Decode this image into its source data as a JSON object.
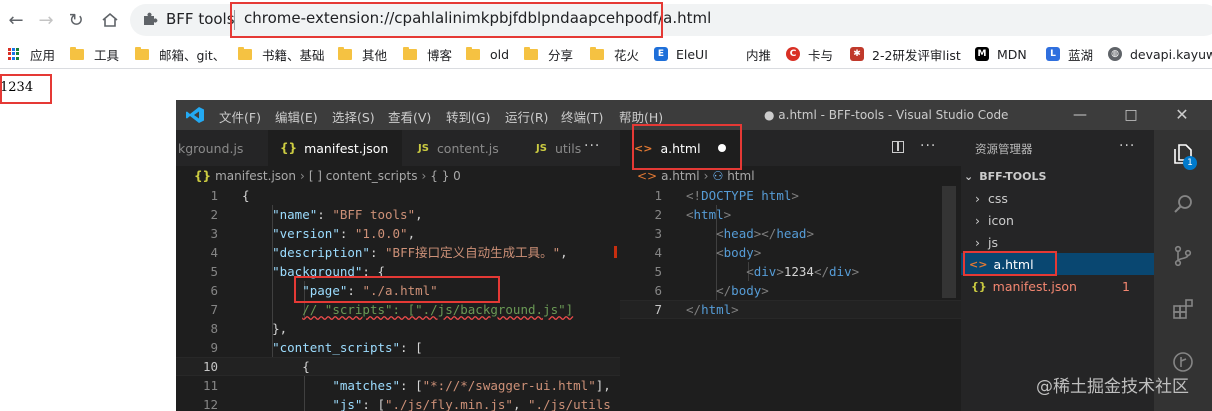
{
  "browser": {
    "site_chip": "BFF tools",
    "url": "chrome-extension://cpahlalinimkpbjfdblpndaapcehpodf/a.html",
    "bookmarks": [
      {
        "label": "应用",
        "icon": "apps-grid-icon"
      },
      {
        "label": "工具",
        "icon": "folder-icon"
      },
      {
        "label": "邮箱、git、",
        "icon": "folder-icon"
      },
      {
        "label": "书籍、基础",
        "icon": "folder-icon"
      },
      {
        "label": "其他",
        "icon": "folder-icon"
      },
      {
        "label": "博客",
        "icon": "folder-icon"
      },
      {
        "label": "old",
        "icon": "folder-icon"
      },
      {
        "label": "分享",
        "icon": "folder-icon"
      },
      {
        "label": "花火",
        "icon": "folder-icon"
      },
      {
        "label": "EleUI",
        "icon": "eleui-icon"
      },
      {
        "label": "内推",
        "icon": "none"
      },
      {
        "label": "卡与",
        "icon": "red-c-icon"
      },
      {
        "label": "2-2研发评审list",
        "icon": "bug-icon"
      },
      {
        "label": "MDN",
        "icon": "mdn-icon"
      },
      {
        "label": "蓝湖",
        "icon": "lanhu-icon"
      },
      {
        "label": "devapi.kayuwa",
        "icon": "globe-icon"
      }
    ]
  },
  "page": {
    "content": "1234"
  },
  "vscode": {
    "menu": [
      "文件(F)",
      "编辑(E)",
      "选择(S)",
      "查看(V)",
      "转到(G)",
      "运行(R)",
      "终端(T)",
      "帮助(H)"
    ],
    "window_title": "● a.html - BFF-tools - Visual Studio Code",
    "left_tabs": [
      "kground.js",
      "manifest.json",
      "content.js",
      "utils"
    ],
    "left_crumbs": [
      "manifest.json",
      "[ ] content_scripts",
      "{ } 0"
    ],
    "left_lines": [
      {
        "n": "1",
        "parts": [
          [
            "p",
            "{"
          ]
        ]
      },
      {
        "n": "2",
        "parts": [
          [
            "p",
            "    "
          ],
          [
            "k",
            "\"name\""
          ],
          [
            "p",
            ": "
          ],
          [
            "s",
            "\"BFF tools\""
          ],
          [
            "p",
            ","
          ]
        ]
      },
      {
        "n": "3",
        "parts": [
          [
            "p",
            "    "
          ],
          [
            "k",
            "\"version\""
          ],
          [
            "p",
            ": "
          ],
          [
            "s",
            "\"1.0.0\""
          ],
          [
            "p",
            ","
          ]
        ]
      },
      {
        "n": "4",
        "parts": [
          [
            "p",
            "    "
          ],
          [
            "k",
            "\"description\""
          ],
          [
            "p",
            ": "
          ],
          [
            "s",
            "\"BFF接口定义自动生成工具。\""
          ],
          [
            "p",
            ","
          ]
        ]
      },
      {
        "n": "5",
        "parts": [
          [
            "p",
            "    "
          ],
          [
            "k",
            "\"background\""
          ],
          [
            "p",
            ": {"
          ]
        ]
      },
      {
        "n": "6",
        "parts": [
          [
            "p",
            "        "
          ],
          [
            "k",
            "\"page\""
          ],
          [
            "p",
            ": "
          ],
          [
            "s",
            "\"./a.html\""
          ]
        ]
      },
      {
        "n": "7",
        "parts": [
          [
            "p",
            "        "
          ],
          [
            "c",
            "// \"scripts\": [\"./js/background.js\"]"
          ]
        ]
      },
      {
        "n": "8",
        "parts": [
          [
            "p",
            "    },"
          ]
        ]
      },
      {
        "n": "9",
        "parts": [
          [
            "p",
            "    "
          ],
          [
            "k",
            "\"content_scripts\""
          ],
          [
            "p",
            ": ["
          ]
        ]
      },
      {
        "n": "10",
        "parts": [
          [
            "p",
            "        {"
          ]
        ]
      },
      {
        "n": "11",
        "parts": [
          [
            "p",
            "            "
          ],
          [
            "k",
            "\"matches\""
          ],
          [
            "p",
            ": ["
          ],
          [
            "s",
            "\"*://*/swagger-ui.html\""
          ],
          [
            "p",
            "],"
          ]
        ]
      },
      {
        "n": "12",
        "parts": [
          [
            "p",
            "            "
          ],
          [
            "k",
            "\"js\""
          ],
          [
            "p",
            ": ["
          ],
          [
            "s",
            "\"./js/fly.min.js\""
          ],
          [
            "p",
            ", "
          ],
          [
            "s",
            "\"./js/utils"
          ]
        ]
      }
    ],
    "right_tab": "a.html",
    "right_crumbs": [
      "a.html",
      "html"
    ],
    "right_lines": [
      {
        "n": "1",
        "parts": [
          [
            "g",
            "<!"
          ],
          [
            "t",
            "DOCTYPE"
          ],
          [
            "p",
            " "
          ],
          [
            "t",
            "html"
          ],
          [
            "g",
            ">"
          ]
        ]
      },
      {
        "n": "2",
        "parts": [
          [
            "g",
            "<"
          ],
          [
            "t",
            "html"
          ],
          [
            "g",
            ">"
          ]
        ]
      },
      {
        "n": "3",
        "parts": [
          [
            "p",
            "    "
          ],
          [
            "g",
            "<"
          ],
          [
            "t",
            "head"
          ],
          [
            "g",
            "></"
          ],
          [
            "t",
            "head"
          ],
          [
            "g",
            ">"
          ]
        ]
      },
      {
        "n": "4",
        "parts": [
          [
            "p",
            "    "
          ],
          [
            "g",
            "<"
          ],
          [
            "t",
            "body"
          ],
          [
            "g",
            ">"
          ]
        ]
      },
      {
        "n": "5",
        "parts": [
          [
            "p",
            "        "
          ],
          [
            "g",
            "<"
          ],
          [
            "t",
            "div"
          ],
          [
            "g",
            ">"
          ],
          [
            "x",
            "1234"
          ],
          [
            "g",
            "</"
          ],
          [
            "t",
            "div"
          ],
          [
            "g",
            ">"
          ]
        ]
      },
      {
        "n": "6",
        "parts": [
          [
            "p",
            "    "
          ],
          [
            "g",
            "</"
          ],
          [
            "t",
            "body"
          ],
          [
            "g",
            ">"
          ]
        ]
      },
      {
        "n": "7",
        "parts": [
          [
            "g",
            "</"
          ],
          [
            "t",
            "html"
          ],
          [
            "g",
            ">"
          ]
        ]
      }
    ],
    "explorer": {
      "header": "资源管理器",
      "root": "BFF-TOOLS",
      "items": [
        {
          "label": "css",
          "type": "folder"
        },
        {
          "label": "icon",
          "type": "folder"
        },
        {
          "label": "js",
          "type": "folder"
        },
        {
          "label": "a.html",
          "type": "html"
        },
        {
          "label": "manifest.json",
          "type": "json",
          "badge": "1"
        }
      ]
    },
    "activity_badge": "1"
  },
  "watermark": "@稀土掘金技术社区",
  "colors": {
    "annotation": "#e53935",
    "vscode_accent": "#007acc"
  }
}
